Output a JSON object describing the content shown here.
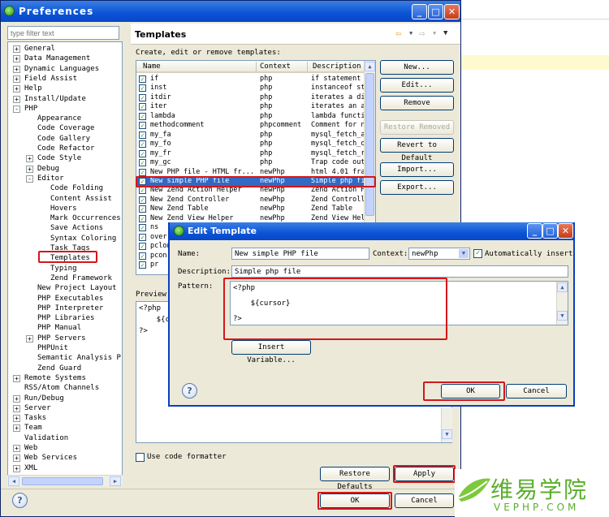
{
  "preferences": {
    "title": "Preferences",
    "filter_placeholder": "type filter text",
    "tree": [
      {
        "label": "General",
        "expander": "+",
        "level": 0
      },
      {
        "label": "Data Management",
        "expander": "+",
        "level": 0
      },
      {
        "label": "Dynamic Languages",
        "expander": "+",
        "level": 0
      },
      {
        "label": "Field Assist",
        "expander": "+",
        "level": 0
      },
      {
        "label": "Help",
        "expander": "+",
        "level": 0
      },
      {
        "label": "Install/Update",
        "expander": "+",
        "level": 0
      },
      {
        "label": "PHP",
        "expander": "-",
        "level": 0
      },
      {
        "label": "Appearance",
        "expander": "",
        "level": 1
      },
      {
        "label": "Code Coverage",
        "expander": "",
        "level": 1
      },
      {
        "label": "Code Gallery",
        "expander": "",
        "level": 1
      },
      {
        "label": "Code Refactor",
        "expander": "",
        "level": 1
      },
      {
        "label": "Code Style",
        "expander": "+",
        "level": 1
      },
      {
        "label": "Debug",
        "expander": "+",
        "level": 1
      },
      {
        "label": "Editor",
        "expander": "-",
        "level": 1
      },
      {
        "label": "Code Folding",
        "expander": "",
        "level": 2
      },
      {
        "label": "Content Assist",
        "expander": "",
        "level": 2
      },
      {
        "label": "Hovers",
        "expander": "",
        "level": 2
      },
      {
        "label": "Mark Occurrences",
        "expander": "",
        "level": 2
      },
      {
        "label": "Save Actions",
        "expander": "",
        "level": 2
      },
      {
        "label": "Syntax Coloring",
        "expander": "",
        "level": 2
      },
      {
        "label": "Task Tags",
        "expander": "",
        "level": 2
      },
      {
        "label": "Templates",
        "expander": "",
        "level": 2
      },
      {
        "label": "Typing",
        "expander": "",
        "level": 2
      },
      {
        "label": "Zend Framework",
        "expander": "",
        "level": 2
      },
      {
        "label": "New Project Layout",
        "expander": "",
        "level": 1
      },
      {
        "label": "PHP Executables",
        "expander": "",
        "level": 1
      },
      {
        "label": "PHP Interpreter",
        "expander": "",
        "level": 1
      },
      {
        "label": "PHP Libraries",
        "expander": "",
        "level": 1
      },
      {
        "label": "PHP Manual",
        "expander": "",
        "level": 1
      },
      {
        "label": "PHP Servers",
        "expander": "+",
        "level": 1
      },
      {
        "label": "PHPUnit",
        "expander": "",
        "level": 1
      },
      {
        "label": "Semantic Analysis Pre",
        "expander": "",
        "level": 1
      },
      {
        "label": "Zend Guard",
        "expander": "",
        "level": 1
      },
      {
        "label": "Remote Systems",
        "expander": "+",
        "level": 0
      },
      {
        "label": "RSS/Atom Channels",
        "expander": "",
        "level": 0
      },
      {
        "label": "Run/Debug",
        "expander": "+",
        "level": 0
      },
      {
        "label": "Server",
        "expander": "+",
        "level": 0
      },
      {
        "label": "Tasks",
        "expander": "+",
        "level": 0
      },
      {
        "label": "Team",
        "expander": "+",
        "level": 0
      },
      {
        "label": "Validation",
        "expander": "",
        "level": 0
      },
      {
        "label": "Web",
        "expander": "+",
        "level": 0
      },
      {
        "label": "Web Services",
        "expander": "+",
        "level": 0
      },
      {
        "label": "XML",
        "expander": "+",
        "level": 0
      }
    ],
    "page_title": "Templates",
    "description": "Create, edit or remove templates:",
    "columns": [
      "Name",
      "Context",
      "Description"
    ],
    "rows": [
      [
        "if",
        "php",
        "if statement"
      ],
      [
        "inst",
        "php",
        "instanceof st"
      ],
      [
        "itdir",
        "php",
        "iterates a di"
      ],
      [
        "iter",
        "php",
        "iterates an a"
      ],
      [
        "lambda",
        "php",
        "lambda functi"
      ],
      [
        "methodcomment",
        "phpcomment",
        "Comment for n"
      ],
      [
        "my_fa",
        "php",
        "mysql_fetch_a"
      ],
      [
        "my_fo",
        "php",
        "mysql_fetch_o"
      ],
      [
        "my_fr",
        "php",
        "mysql_fetch_r"
      ],
      [
        "my_gc",
        "php",
        "Trap code out"
      ],
      [
        "New PHP file - HTML fr...",
        "newPhp",
        "html 4.01 fra"
      ],
      [
        "New simple PHP file",
        "newPhp",
        "Simple php fi"
      ],
      [
        "New Zend Action Helper",
        "newPhp",
        "Zend Action H"
      ],
      [
        "New Zend Controller",
        "newPhp",
        "Zend Controll"
      ],
      [
        "New Zend Table",
        "newPhp",
        "Zend Table"
      ],
      [
        "New Zend View Helper",
        "newPhp",
        "Zend View Hel"
      ],
      [
        "ns",
        "",
        ""
      ],
      [
        "overr",
        "",
        ""
      ],
      [
        "pclon",
        "",
        ""
      ],
      [
        "pcon",
        "",
        ""
      ],
      [
        "pr",
        "",
        ""
      ]
    ],
    "buttons": {
      "new": "New...",
      "edit": "Edit...",
      "remove": "Remove",
      "restore_removed": "Restore Removed",
      "revert": "Revert to Default",
      "import": "Import...",
      "export": "Export...",
      "restore_defaults": "Restore Defaults",
      "apply": "Apply",
      "ok": "OK",
      "cancel": "Cancel"
    },
    "preview_label": "Preview:",
    "preview_lines": [
      "<?php",
      "    ${cur",
      "?>"
    ],
    "use_formatter_label": "Use code formatter"
  },
  "edit_template": {
    "title": "Edit Template",
    "name_label": "Name:",
    "name_value": "New simple PHP file",
    "context_label": "Context:",
    "context_value": "newPhp",
    "auto_insert_label": "Automatically insert",
    "description_label": "Description:",
    "description_value": "Simple php file",
    "pattern_label": "Pattern:",
    "pattern_lines": [
      "<?php",
      "    ${cursor}",
      "?>"
    ],
    "insert_variable_label": "Insert Variable...",
    "ok_label": "OK",
    "cancel_label": "Cancel"
  },
  "watermark": {
    "chinese": "维易学院",
    "latin": "VEPHP.COM"
  },
  "icons": {
    "help": "?",
    "back": "⇦",
    "forward": "⇨",
    "menu": "▼"
  },
  "colors": {
    "title_bar": "#0a53d6",
    "highlight_red": "#d4171b",
    "window_bg": "#ece9d8"
  }
}
